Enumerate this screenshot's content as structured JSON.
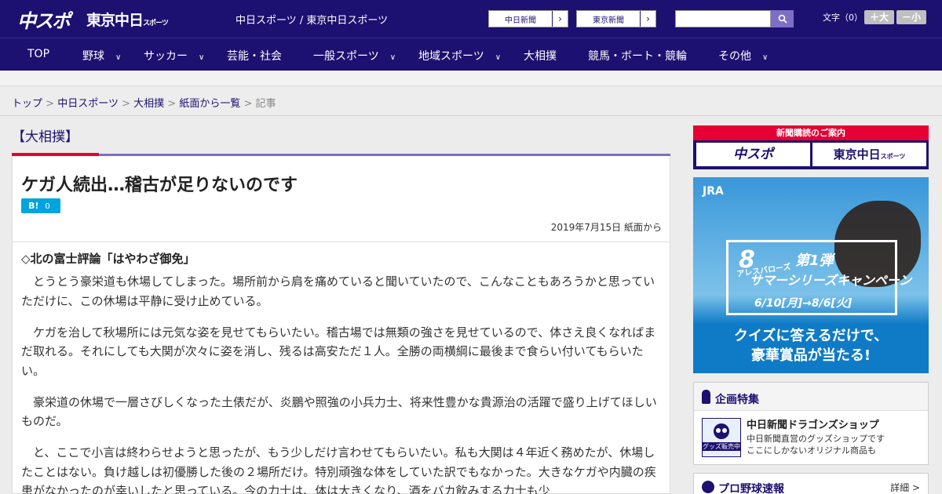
{
  "header": {
    "logo_chuspo": "中スポ",
    "logo_tokyo": "東京中日",
    "logo_tokyo_small": "スポーツ",
    "site_subtitle": "中日スポーツ / 東京中日スポーツ",
    "link_chunichi": "中日新聞",
    "link_tokyo": "東京新聞",
    "arrow": "›",
    "search_icon": "search-icon",
    "fontsize_label": "文字（0）",
    "font_larger": "＋大",
    "font_smaller": "－小"
  },
  "nav": {
    "items": [
      {
        "label": "TOP",
        "has_menu": false
      },
      {
        "label": "野球",
        "has_menu": true
      },
      {
        "label": "サッカー",
        "has_menu": true
      },
      {
        "label": "芸能・社会",
        "has_menu": false
      },
      {
        "label": "一般スポーツ",
        "has_menu": true
      },
      {
        "label": "地域スポーツ",
        "has_menu": true
      },
      {
        "label": "大相撲",
        "has_menu": false
      },
      {
        "label": "競馬・ボート・競輪",
        "has_menu": false
      },
      {
        "label": "その他",
        "has_menu": true
      }
    ],
    "chevron": "∨"
  },
  "breadcrumb": {
    "items": [
      "トップ",
      "中日スポーツ",
      "大相撲",
      "紙面から一覧"
    ],
    "current": "記事",
    "separator": ">"
  },
  "article": {
    "category": "【大相撲】",
    "title": "ケガ人続出…稽古が足りないのです",
    "hatena_label": "B!",
    "hatena_count": "0",
    "date": "2019年7月15日 紙面から",
    "subhead": "◇北の富士評論「はやわざ御免」",
    "paragraphs": [
      "とうとう豪栄道も休場してしまった。場所前から肩を痛めていると聞いていたので、こんなこともあろうかと思っていただけに、この休場は平静に受け止めている。",
      "ケガを治して秋場所には元気な姿を見せてもらいたい。稽古場では無類の強さを見せているので、体さえ良くなればまだ取れる。それにしても大関が次々に姿を消し、残るは高安ただ１人。全勝の両横綱に最後まで食らい付いてもらいたい。",
      "豪栄道の休場で一層さびしくなった土俵だが、炎鵬や照強の小兵力士、将来性豊かな貴源治の活躍で盛り上げてほしいものだ。",
      "と、ここで小言は終わらせようと思ったが、もう少しだけ言わせてもらいたい。私も大関は４年近く務めたが、休場したことはない。負け越しは初優勝した後の２場所だけ。特別頑強な体をしていた訳でもなかった。大きなケガや内臓の疾患がなかったのが幸いしたと思っている。今の力士は、体は大きくなり、酒をバカ飲みする力士も少"
    ]
  },
  "sidebar": {
    "subscribe": {
      "header": "新聞購読のご案内",
      "logo_chuspo": "中スポ",
      "logo_tokyo": "東京中日",
      "logo_tokyo_small": "スポーツ"
    },
    "ad": {
      "brand": "JRA",
      "number": "8",
      "horse_name": "アレスバローズ",
      "stage": "第1弾",
      "campaign": "サマーシリーズキャンペーン",
      "dates": "6/10[月]→8/6[火]",
      "cta_line1": "クイズに答えるだけで、",
      "cta_line2": "豪華賞品が当たる!"
    },
    "feature": {
      "heading": "企画特集",
      "title": "中日新聞ドラゴンズショップ",
      "desc_line1": "中日新聞直営のグッズショップです",
      "desc_line2": "ここにしかないオリジナル商品も",
      "thumb_label": "グッズ販売中"
    },
    "baseball": {
      "heading": "プロ野球速報",
      "more": "詳細 >"
    }
  },
  "colors": {
    "brand_navy": "#1c1070",
    "accent_red": "#e60033",
    "accent_purple": "#7d6fc5",
    "hatena_blue": "#00a4de"
  }
}
